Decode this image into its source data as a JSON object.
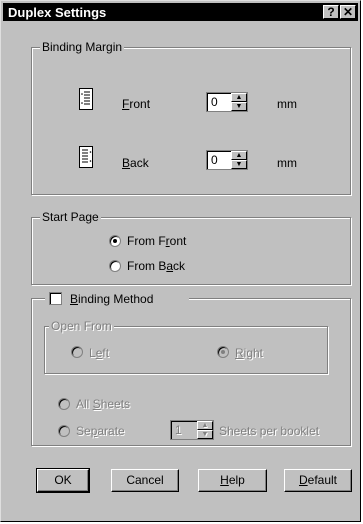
{
  "window": {
    "title": "Duplex Settings",
    "help_glyph": "?",
    "close_glyph": "✕"
  },
  "binding_margin": {
    "label": "Binding Margin",
    "front": {
      "label_pre": "",
      "label_ul": "F",
      "label_post": "ront",
      "value": "0",
      "unit": "mm"
    },
    "back": {
      "label_pre": "",
      "label_ul": "B",
      "label_post": "ack",
      "value": "0",
      "unit": "mm"
    }
  },
  "start_page": {
    "label": "Start Page",
    "from_front": {
      "pre": "From F",
      "ul": "r",
      "post": "ont",
      "selected": true
    },
    "from_back": {
      "pre": "From B",
      "ul": "a",
      "post": "ck",
      "selected": false
    }
  },
  "binding_method": {
    "pre": "",
    "ul": "B",
    "post": "inding Method",
    "checked": false,
    "open_from": {
      "label": "Open From",
      "left": {
        "pre": "L",
        "ul": "e",
        "post": "ft"
      },
      "right": {
        "pre": "",
        "ul": "R",
        "post": "ight"
      }
    },
    "all_sheets": {
      "pre": "All ",
      "ul": "S",
      "post": "heets"
    },
    "separate": {
      "pre": "Se",
      "ul": "p",
      "post": "arate"
    },
    "sheets_value": "1",
    "sheets_label": "Sheets per booklet"
  },
  "buttons": {
    "ok": "OK",
    "cancel": "Cancel",
    "help": {
      "pre": "",
      "ul": "H",
      "post": "elp"
    },
    "default": {
      "pre": "",
      "ul": "D",
      "post": "efault"
    }
  }
}
